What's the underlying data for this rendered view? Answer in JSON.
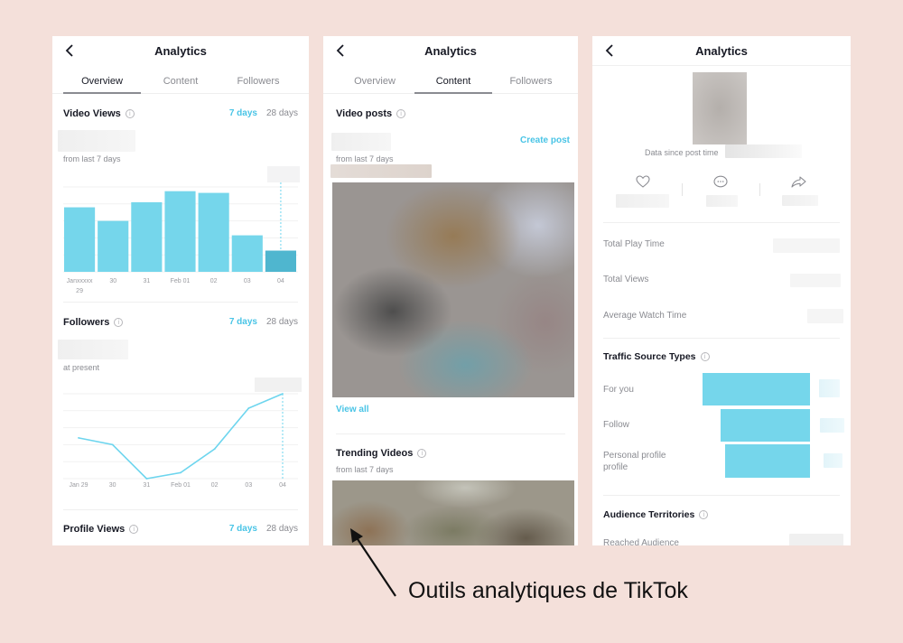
{
  "panels": {
    "overview": {
      "nav_title": "Analytics",
      "tabs": [
        "Overview",
        "Content",
        "Followers"
      ],
      "active_tab": "Overview",
      "video_views": {
        "title": "Video Views",
        "range_active": "7 days",
        "range_other": "28 days",
        "subtitle": "from last 7 days"
      },
      "followers": {
        "title": "Followers",
        "range_active": "7 days",
        "range_other": "28 days",
        "subtitle": "at present"
      },
      "profile_views": {
        "title": "Profile Views",
        "range_active": "7 days",
        "range_other": "28 days"
      }
    },
    "content": {
      "nav_title": "Analytics",
      "tabs": [
        "Overview",
        "Content",
        "Followers"
      ],
      "active_tab": "Content",
      "video_posts": {
        "title": "Video posts",
        "create_post": "Create post",
        "subtitle": "from last 7 days",
        "view_all": "View all"
      },
      "trending": {
        "title": "Trending Videos",
        "subtitle": "from last 7 days"
      }
    },
    "video_detail": {
      "nav_title": "Analytics",
      "data_since": "Data since post time",
      "stats_icons": [
        "heart-icon",
        "comment-icon",
        "share-icon"
      ],
      "metrics": [
        {
          "label": "Total Play Time"
        },
        {
          "label": "Total Views"
        },
        {
          "label": "Average Watch Time"
        }
      ],
      "traffic": {
        "title": "Traffic Source Types",
        "sources": [
          {
            "label": "For you",
            "share": 1.0
          },
          {
            "label": "Follow",
            "share": 0.83
          },
          {
            "label": "Personal profile profile",
            "share": 0.79
          }
        ]
      },
      "audience": {
        "title": "Audience Territories",
        "reached_label": "Reached Audience"
      }
    }
  },
  "caption": "Outils analytiques de TikTok",
  "colors": {
    "accent": "#49c4e6",
    "bar": "#75d6eb",
    "bar_selected": "#4fb6cf",
    "line": "#6dd5ee",
    "background": "#f4e0da"
  },
  "chart_data": [
    {
      "type": "bar",
      "title": "Video Views",
      "categories": [
        "Janxxxxx 29",
        "30",
        "31",
        "Feb 01",
        "02",
        "03",
        "04"
      ],
      "values": [
        3.8,
        3.0,
        4.1,
        4.75,
        4.65,
        2.15,
        1.25
      ],
      "selected_index": 6,
      "ylim": [
        0,
        5
      ],
      "grid": true,
      "xlabel": "",
      "ylabel": ""
    },
    {
      "type": "line",
      "title": "Followers",
      "categories": [
        "Jan 29",
        "30",
        "31",
        "Feb 01",
        "02",
        "03",
        "04"
      ],
      "values": [
        2.4,
        2.0,
        0.0,
        0.35,
        1.75,
        4.15,
        5.0
      ],
      "selected_index": 6,
      "ylim": [
        0,
        5
      ],
      "grid": true,
      "xlabel": "",
      "ylabel": ""
    }
  ]
}
